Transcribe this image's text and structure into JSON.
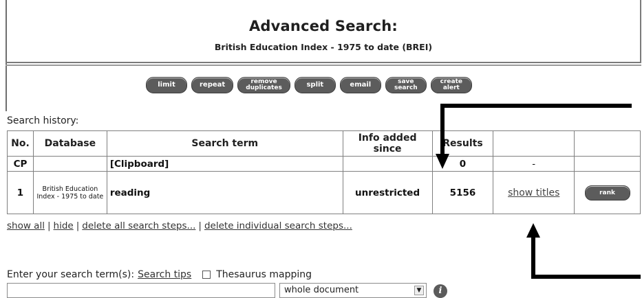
{
  "page": {
    "title": "Advanced Search:",
    "subtitle": "British Education Index - 1975 to date (BREI)"
  },
  "toolbar": {
    "buttons": [
      {
        "label": "limit"
      },
      {
        "label": "repeat"
      },
      {
        "label_line1": "remove",
        "label_line2": "duplicates"
      },
      {
        "label": "split"
      },
      {
        "label": "email"
      },
      {
        "label_line1": "save",
        "label_line2": "search"
      },
      {
        "label_line1": "create",
        "label_line2": "alert"
      }
    ]
  },
  "history": {
    "label": "Search history:",
    "headers": {
      "no": "No.",
      "database": "Database",
      "term": "Search term",
      "info": "Info added since",
      "results": "Results",
      "titles": "",
      "rank": ""
    },
    "rows": [
      {
        "no": "CP",
        "database": "",
        "term": "[Clipboard]",
        "info": "",
        "results": "0",
        "titles": "-",
        "rank": ""
      },
      {
        "no": "1",
        "database": "British Education Index - 1975 to date",
        "term": "reading",
        "info": "unrestricted",
        "results": "5156",
        "titles": "show titles",
        "rank": "rank"
      }
    ]
  },
  "footer_links": {
    "show_all": "show all",
    "hide": "hide",
    "delete_all": "delete all search steps...",
    "delete_individual": "delete individual search steps..."
  },
  "search": {
    "prompt": "Enter your search term(s):",
    "tips": "Search tips",
    "thesaurus": "Thesaurus mapping",
    "input_value": "",
    "scope": "whole document"
  },
  "icons": {
    "info": "info-icon",
    "dropdown": "chevron-down-icon"
  }
}
